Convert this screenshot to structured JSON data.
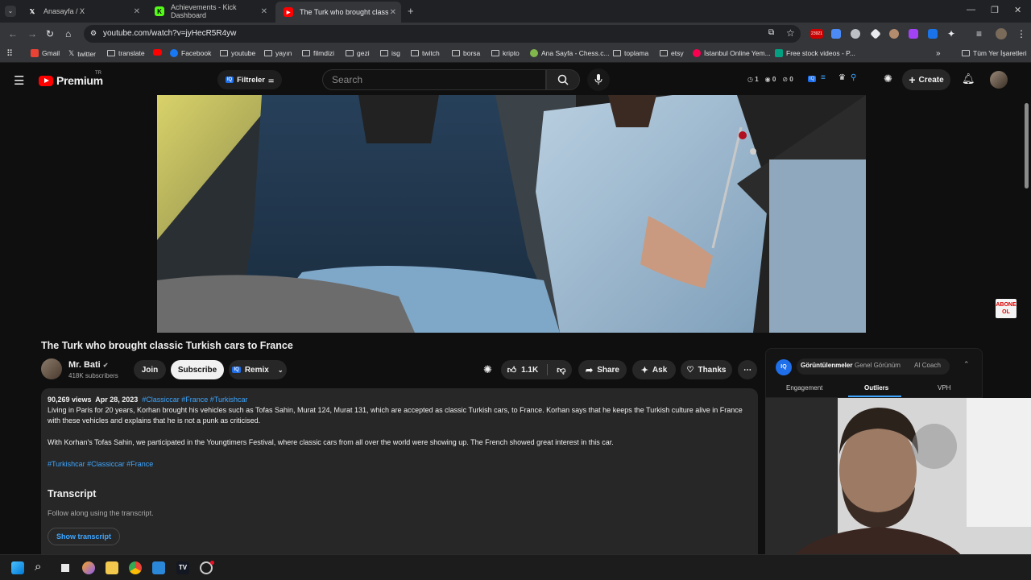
{
  "browser": {
    "tabs": [
      {
        "label": "Anasayfa / X",
        "icon": "x-logo-icon"
      },
      {
        "label": "Achievements - Kick Dashboard",
        "icon": "kick-logo-icon"
      },
      {
        "label": "The Turk who brought classic T",
        "icon": "youtube-logo-icon",
        "active": true
      }
    ],
    "url": "youtube.com/watch?v=jyHecR5R4yw",
    "ext_badge": "23921",
    "bookmarks": [
      {
        "label": "Gmail",
        "icon": "gmail-icon"
      },
      {
        "label": "twitter",
        "icon": "x-icon"
      },
      {
        "label": "translate",
        "icon": "folder-icon"
      },
      {
        "label": "",
        "icon": "youtube-icon"
      },
      {
        "label": "Facebook",
        "icon": "facebook-icon"
      },
      {
        "label": "youtube",
        "icon": "folder-icon"
      },
      {
        "label": "yayın",
        "icon": "folder-icon"
      },
      {
        "label": "filmdizi",
        "icon": "folder-icon"
      },
      {
        "label": "gezi",
        "icon": "folder-icon"
      },
      {
        "label": "isg",
        "icon": "folder-icon"
      },
      {
        "label": "twitch",
        "icon": "folder-icon"
      },
      {
        "label": "borsa",
        "icon": "folder-icon"
      },
      {
        "label": "kripto",
        "icon": "folder-icon"
      },
      {
        "label": "Ana Sayfa - Chess.c...",
        "icon": "chess-icon"
      },
      {
        "label": "toplama",
        "icon": "folder-icon"
      },
      {
        "label": "etsy",
        "icon": "folder-icon"
      },
      {
        "label": "İstanbul Online Yem...",
        "icon": "yemeksepeti-icon"
      },
      {
        "label": "Free stock videos - P...",
        "icon": "pexels-icon"
      }
    ],
    "all_bookmarks": "Tüm Yer İşaretleri"
  },
  "youtube": {
    "logo_text": "Premium",
    "logo_region": "TR",
    "filter_label": "Filtreler",
    "search_placeholder": "Search",
    "create_label": "Create",
    "counters": [
      "1",
      "0",
      "0"
    ]
  },
  "video": {
    "title": "The Turk who brought classic Turkish cars to France",
    "channel": "Mr. Bati",
    "subscribers": "418K subscribers",
    "join_label": "Join",
    "subscribe_label": "Subscribe",
    "remix_label": "Remix",
    "likes": "1.1K",
    "share_label": "Share",
    "ask_label": "Ask",
    "thanks_label": "Thanks",
    "overlay_badge": "ABONE OL"
  },
  "description": {
    "views": "90,269 views",
    "date": "Apr 28, 2023",
    "tags": "#Classiccar #France #Turkishcar",
    "paragraph1": "Living in Paris for 20 years, Korhan brought his vehicles such as Tofas Sahin, Murat 124, Murat 131, which are accepted as classic Turkish cars, to France. Korhan says that he keeps the Turkish culture alive in France with these vehicles and explains that he is not a punk as criticised.",
    "paragraph2": "With Korhan's Tofas Sahin, we participated in the Youngtimers Festival, where classic cars from all over the world were showing up. The French showed great interest in this car.",
    "hashtags": "#Turkishcar #Classiccar #France",
    "transcript_title": "Transcript",
    "transcript_sub": "Follow along using the transcript.",
    "transcript_button": "Show transcript"
  },
  "panel": {
    "tabs_top": [
      "Görüntülenmeler",
      "Genel Görünüm",
      "AI Coach"
    ],
    "tabs_bottom": [
      "Engagement",
      "Outliers",
      "VPH"
    ],
    "active_bottom": "Outliers"
  },
  "colors": {
    "accent": "#3ea6ff",
    "brand": "#ff0000"
  }
}
